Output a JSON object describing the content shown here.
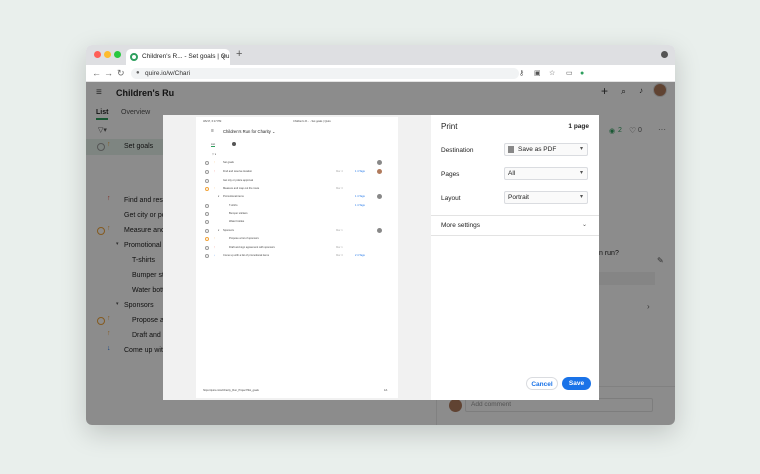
{
  "browser": {
    "tab_title": "Children's R... - Set goals | Qu",
    "tab_close": "×",
    "new_tab": "+",
    "url": "quire.io/w/Chari",
    "close": "●"
  },
  "app": {
    "project_title": "Children's Ru",
    "tabs": [
      {
        "label": "List"
      },
      {
        "label": "Overview"
      }
    ],
    "tasks": [
      {
        "label": "Set goals"
      },
      {
        "label": "Find and rese"
      },
      {
        "label": "Get city or po"
      },
      {
        "label": "Measure and"
      },
      {
        "label": "Promotional it"
      },
      {
        "label": "T-shirts"
      },
      {
        "label": "Bumper sti"
      },
      {
        "label": "Water bott"
      },
      {
        "label": "Sponsors"
      },
      {
        "label": "Propose a"
      },
      {
        "label": "Draft and s"
      },
      {
        "label": "Come up with"
      }
    ],
    "right": {
      "views": "2",
      "likes": "0",
      "question": "n run?",
      "add_comment": "Add comment"
    }
  },
  "preview": {
    "date": "3/6/17, 6:17 PM",
    "header_title": "Children's R... - Set goals | Quire",
    "project": "Children's Run for Charity ⌄",
    "tab": "List",
    "rows": [
      {
        "label": "Set goals",
        "tag": ""
      },
      {
        "label": "Find and reserve location",
        "tag": "Mar 4"
      },
      {
        "label": "Get city or police approval",
        "tag": ""
      },
      {
        "label": "Measure and map out the route",
        "tag": "Mar 3"
      },
      {
        "label": "Promotional items",
        "tag": ""
      },
      {
        "label": "T-shirts",
        "tag": ""
      },
      {
        "label": "Bumper stickers",
        "tag": ""
      },
      {
        "label": "Water bottles",
        "tag": ""
      },
      {
        "label": "Sponsors",
        "tag": "Mar 1"
      },
      {
        "label": "Propose a list of sponsors",
        "tag": ""
      },
      {
        "label": "Draft and sign agreement with sponsors",
        "tag": "Mar 1"
      },
      {
        "label": "Come up with a list of promotional items",
        "tag": "Mar 3"
      }
    ],
    "tags_blue": [
      "1 4 Tags",
      "1 4 Tags",
      "1 4 Tags",
      "2 4 Tags"
    ],
    "footer_url": "https://quire.io/w/Charity_Run_Project?list_goals",
    "footer_page": "1/1"
  },
  "print": {
    "title": "Print",
    "pages_count": "1 page",
    "destination_label": "Destination",
    "destination_value": "Save as PDF",
    "pages_label": "Pages",
    "pages_value": "All",
    "layout_label": "Layout",
    "layout_value": "Portrait",
    "more_settings": "More settings",
    "cancel": "Cancel",
    "save": "Save"
  },
  "colors": {
    "accent_green": "#2e9f5e",
    "blue": "#1a73e8",
    "orange": "#f2a43a",
    "red": "#e84a3b"
  }
}
